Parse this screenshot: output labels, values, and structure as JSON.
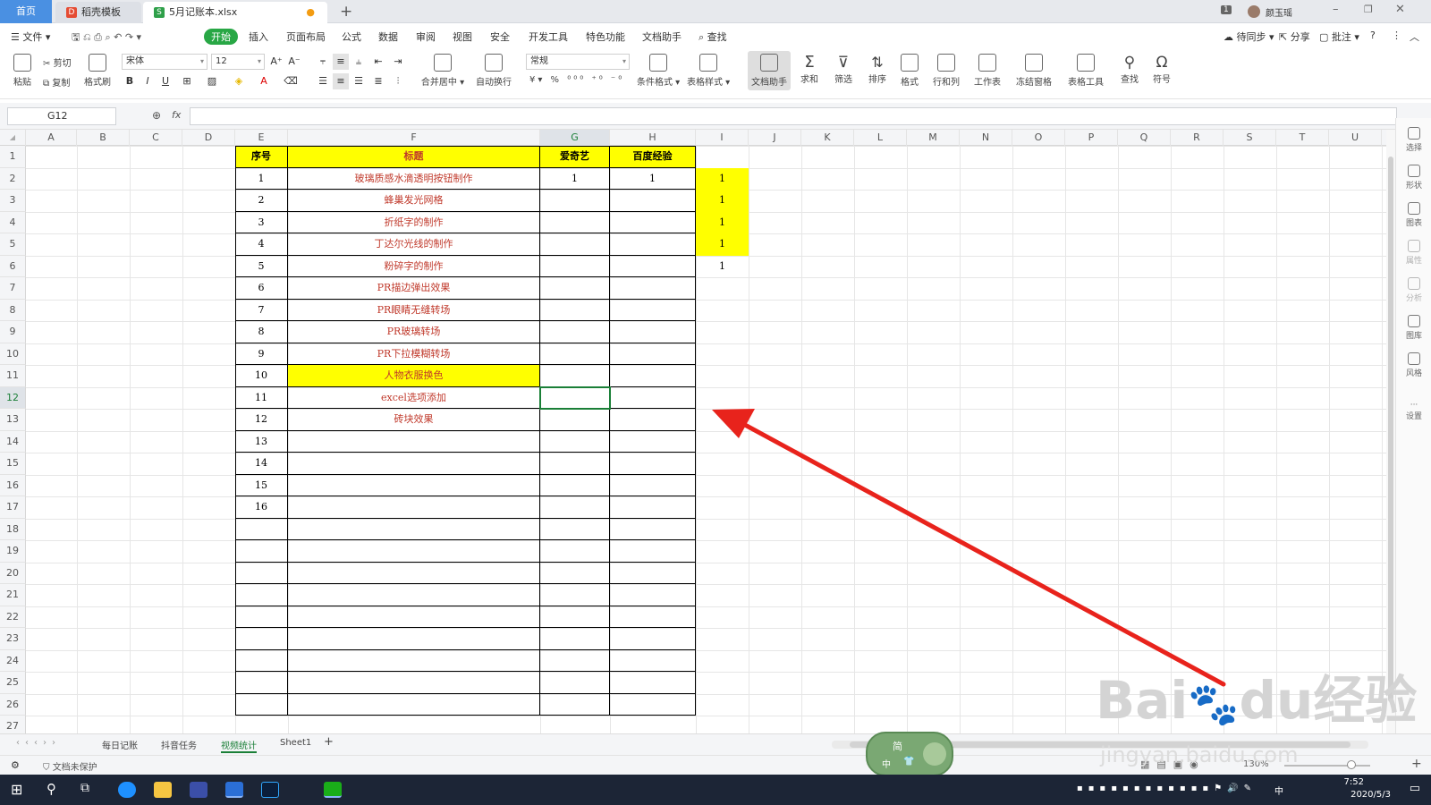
{
  "window": {
    "tabs": [
      {
        "label": "首页"
      },
      {
        "label": "稻壳模板"
      },
      {
        "label": "5月记账本.xlsx"
      }
    ],
    "new_tab": "+",
    "badge": "1",
    "user": "颜玉瑶"
  },
  "menu": {
    "file": "文件",
    "items": [
      "开始",
      "插入",
      "页面布局",
      "公式",
      "数据",
      "审阅",
      "视图",
      "安全",
      "开发工具",
      "特色功能",
      "文档助手"
    ],
    "search": "查找",
    "sync": "待同步",
    "share": "分享",
    "comment": "批注"
  },
  "ribbon": {
    "paste": "粘贴",
    "cut": "剪切",
    "copy": "复制",
    "format_painter": "格式刷",
    "font": "宋体",
    "font_size": "12",
    "merge": "合并居中",
    "wrap": "自动换行",
    "number_format": "常规",
    "groups": [
      "条件格式",
      "表格样式",
      "文档助手",
      "求和",
      "筛选",
      "排序",
      "格式",
      "行和列",
      "工作表",
      "冻结窗格",
      "表格工具",
      "查找",
      "符号"
    ]
  },
  "formula": {
    "cell_ref": "G12",
    "fx": "fx",
    "value": ""
  },
  "sheet": {
    "columns": [
      "A",
      "B",
      "C",
      "D",
      "E",
      "F",
      "G",
      "H",
      "I",
      "J",
      "K",
      "L",
      "M",
      "N",
      "O",
      "P",
      "Q",
      "R",
      "S",
      "T",
      "U"
    ],
    "selected_column": "G",
    "selected_row": 12,
    "header": {
      "num": "序号",
      "title": "标题",
      "g": "爱奇艺",
      "h": "百度经验"
    },
    "rows": [
      {
        "num": "1",
        "title": "玻璃质感水滴透明按钮制作",
        "g": "1",
        "h": "1",
        "i": "1"
      },
      {
        "num": "2",
        "title": "蜂巢发光网格",
        "g": "",
        "h": "",
        "i": "1"
      },
      {
        "num": "3",
        "title": "折纸字的制作",
        "g": "",
        "h": "",
        "i": "1"
      },
      {
        "num": "4",
        "title": "丁达尔光线的制作",
        "g": "",
        "h": "",
        "i": "1"
      },
      {
        "num": "5",
        "title": "粉碎字的制作",
        "g": "",
        "h": "",
        "i": "1"
      },
      {
        "num": "6",
        "title": "PR描边弹出效果",
        "g": "",
        "h": "",
        "i": ""
      },
      {
        "num": "7",
        "title": "PR眼睛无缝转场",
        "g": "",
        "h": "",
        "i": ""
      },
      {
        "num": "8",
        "title": "PR玻璃转场",
        "g": "",
        "h": "",
        "i": ""
      },
      {
        "num": "9",
        "title": "PR下拉模糊转场",
        "g": "",
        "h": "",
        "i": ""
      },
      {
        "num": "10",
        "title": "人物衣服换色",
        "g": "",
        "h": "",
        "i": ""
      },
      {
        "num": "11",
        "title": "excel选项添加",
        "g": "",
        "h": "",
        "i": ""
      },
      {
        "num": "12",
        "title": "砖块效果",
        "g": "",
        "h": "",
        "i": ""
      },
      {
        "num": "13",
        "title": "",
        "g": "",
        "h": "",
        "i": ""
      },
      {
        "num": "14",
        "title": "",
        "g": "",
        "h": "",
        "i": ""
      },
      {
        "num": "15",
        "title": "",
        "g": "",
        "h": "",
        "i": ""
      },
      {
        "num": "16",
        "title": "",
        "g": "",
        "h": "",
        "i": ""
      }
    ]
  },
  "sidebar": [
    "选择",
    "形状",
    "图表",
    "属性",
    "分析",
    "图库",
    "风格",
    "设置"
  ],
  "sheet_tabs": [
    "每日记账",
    "抖音任务",
    "视频统计",
    "Sheet1"
  ],
  "active_sheet": "视频统计",
  "status": {
    "protect": "文档未保护",
    "zoom": "130%"
  },
  "ime": {
    "mode": "简",
    "lang": "中"
  },
  "watermark": {
    "brand": "Bai",
    "brand2": "du",
    "suffix": "经验",
    "url": "jingyan.baidu.com"
  },
  "clock": {
    "time": "7:52",
    "date": "2020/5/3"
  },
  "colors": {
    "accent": "#1a7f37",
    "highlight": "#ffff00",
    "arrow": "#e8231c",
    "title_text": "#c0392b"
  }
}
